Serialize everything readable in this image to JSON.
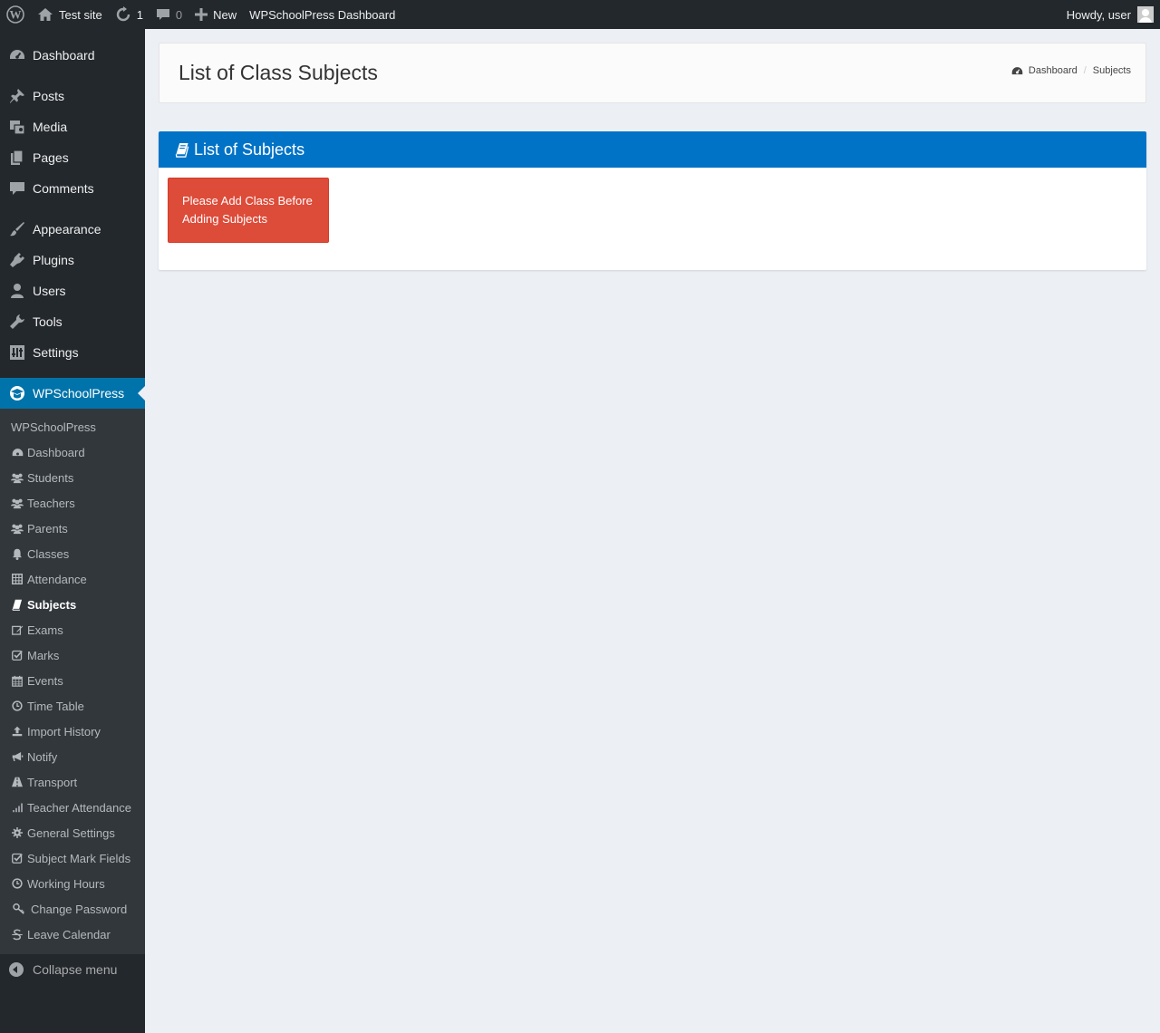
{
  "adminbar": {
    "site_name": "Test site",
    "updates_count": "1",
    "comments_count": "0",
    "new_label": "New",
    "dashboard_link": "WPSchoolPress Dashboard",
    "greeting": "Howdy, user"
  },
  "sidebar": {
    "items": [
      {
        "label": "Dashboard",
        "icon": "dashboard-icon"
      },
      {
        "label": "Posts",
        "icon": "pin-icon"
      },
      {
        "label": "Media",
        "icon": "media-icon"
      },
      {
        "label": "Pages",
        "icon": "pages-icon"
      },
      {
        "label": "Comments",
        "icon": "comment-icon"
      },
      {
        "label": "Appearance",
        "icon": "brush-icon"
      },
      {
        "label": "Plugins",
        "icon": "plugin-icon"
      },
      {
        "label": "Users",
        "icon": "user-icon"
      },
      {
        "label": "Tools",
        "icon": "wrench-icon"
      },
      {
        "label": "Settings",
        "icon": "settings-icon"
      },
      {
        "label": "WPSchoolPress",
        "icon": "school-icon"
      }
    ],
    "submenu_header": "WPSchoolPress",
    "submenu": [
      {
        "label": "Dashboard",
        "icon": "dashboard-icon"
      },
      {
        "label": "Students",
        "icon": "users-icon"
      },
      {
        "label": "Teachers",
        "icon": "users-icon"
      },
      {
        "label": "Parents",
        "icon": "users-icon"
      },
      {
        "label": "Classes",
        "icon": "bell-icon"
      },
      {
        "label": "Attendance",
        "icon": "table-icon"
      },
      {
        "label": "Subjects",
        "icon": "book-icon"
      },
      {
        "label": "Exams",
        "icon": "edit-icon"
      },
      {
        "label": "Marks",
        "icon": "check-square-icon"
      },
      {
        "label": "Events",
        "icon": "calendar-icon"
      },
      {
        "label": "Time Table",
        "icon": "clock-icon"
      },
      {
        "label": "Import History",
        "icon": "upload-icon"
      },
      {
        "label": "Notify",
        "icon": "bullhorn-icon"
      },
      {
        "label": "Transport",
        "icon": "road-icon"
      },
      {
        "label": "Teacher Attendance",
        "icon": "signal-icon"
      },
      {
        "label": "General Settings",
        "icon": "gear-icon"
      },
      {
        "label": "Subject Mark Fields",
        "icon": "check-square-icon"
      },
      {
        "label": "Working Hours",
        "icon": "clock-icon"
      },
      {
        "label": "Change Password",
        "icon": "key-icon"
      },
      {
        "label": "Leave Calendar",
        "icon": "strikethrough-icon"
      }
    ],
    "collapse_label": "Collapse menu"
  },
  "page": {
    "title": "List of Class Subjects",
    "breadcrumb_home": "Dashboard",
    "breadcrumb_current": "Subjects"
  },
  "box": {
    "title": "List of Subjects",
    "alert_text": "Please Add Class Before Adding Subjects"
  },
  "colors": {
    "adminbar_bg": "#23282d",
    "accent": "#0073aa",
    "box_header": "#0073c7",
    "alert": "#dd4b39"
  }
}
